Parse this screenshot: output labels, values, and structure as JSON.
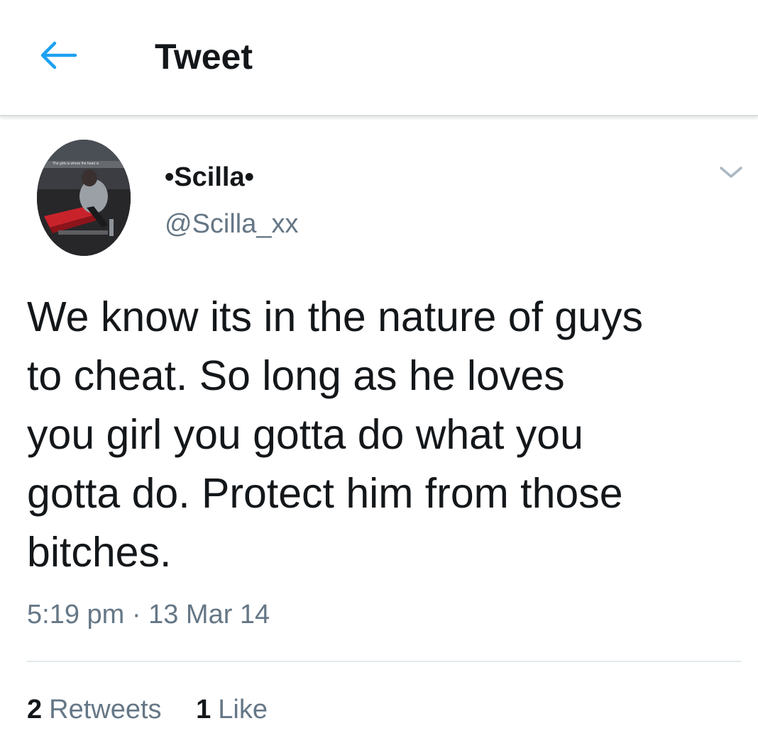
{
  "header": {
    "title": "Tweet",
    "back_icon": "arrow-left-icon",
    "accent_color": "#1da1f2"
  },
  "tweet": {
    "author": {
      "display_name": "•Scilla•",
      "handle": "@Scilla_xx",
      "avatar_caption": "The girls is where the heart is"
    },
    "text_lines": [
      "We know its in the nature of guys",
      "to cheat. So long as he loves",
      "you girl you gotta do what you",
      "gotta do. Protect him from those",
      "bitches."
    ],
    "time": "5:19 pm",
    "separator": "·",
    "date": "13 Mar 14",
    "more_icon": "chevron-down-icon"
  },
  "stats": {
    "retweets_count": "2",
    "retweets_label": "Retweets",
    "likes_count": "1",
    "likes_label": "Like"
  }
}
